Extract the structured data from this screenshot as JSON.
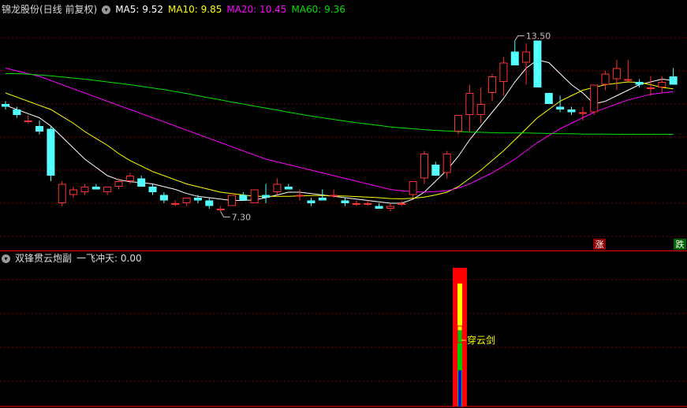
{
  "colors": {
    "up": "#ff3232",
    "down": "#54ffff",
    "ma5": "#ffffff",
    "ma10": "#ffff00",
    "ma20": "#ff00ff",
    "ma60": "#00e000",
    "grid": "#7a0000",
    "axis": "#ff0000",
    "label": "#c0c0c0"
  },
  "main_header": {
    "title": "锦龙股份(日线 前复权)",
    "ma5": "MA5: 9.52",
    "ma10": "MA10: 9.85",
    "ma20": "MA20: 10.45",
    "ma60": "MA60: 9.36"
  },
  "sub_header": {
    "title": "双锋贯云炮副",
    "indicator": "一飞冲天: 0.00"
  },
  "chart_data": [
    {
      "type": "candlestick",
      "title": "锦龙股份(日线 前复权)",
      "ylim": [
        6.0,
        14.4
      ],
      "high_marker": "13.50",
      "low_marker": "7.30",
      "badges": [
        "涨",
        "跌"
      ],
      "series": [
        {
          "name": "K线",
          "ohlc": [
            [
              11.2,
              11.3,
              11.0,
              11.1
            ],
            [
              11.0,
              11.1,
              10.7,
              10.8
            ],
            [
              10.6,
              10.8,
              10.5,
              10.6
            ],
            [
              10.4,
              10.6,
              10.1,
              10.2
            ],
            [
              10.3,
              10.4,
              8.4,
              8.6
            ],
            [
              7.6,
              8.4,
              7.5,
              8.3
            ],
            [
              7.9,
              8.2,
              7.8,
              8.1
            ],
            [
              8.0,
              8.3,
              7.9,
              8.2
            ],
            [
              8.2,
              8.3,
              8.1,
              8.1
            ],
            [
              8.0,
              8.2,
              7.9,
              8.2
            ],
            [
              8.2,
              8.5,
              8.1,
              8.4
            ],
            [
              8.4,
              8.7,
              8.3,
              8.6
            ],
            [
              8.5,
              8.6,
              8.2,
              8.2
            ],
            [
              8.2,
              8.3,
              7.9,
              8.0
            ],
            [
              7.9,
              8.0,
              7.6,
              7.7
            ],
            [
              7.6,
              7.7,
              7.5,
              7.6
            ],
            [
              7.6,
              7.8,
              7.5,
              7.8
            ],
            [
              7.8,
              7.9,
              7.6,
              7.7
            ],
            [
              7.7,
              7.8,
              7.4,
              7.5
            ],
            [
              7.4,
              7.5,
              7.3,
              7.4
            ],
            [
              7.5,
              7.9,
              7.5,
              7.9
            ],
            [
              7.9,
              8.0,
              7.7,
              7.7
            ],
            [
              7.6,
              8.1,
              7.6,
              8.1
            ],
            [
              7.9,
              8.3,
              7.6,
              7.8
            ],
            [
              8.0,
              8.5,
              7.9,
              8.3
            ],
            [
              8.2,
              8.3,
              8.1,
              8.1
            ],
            [
              7.9,
              8.1,
              7.7,
              7.9
            ],
            [
              7.7,
              7.8,
              7.5,
              7.6
            ],
            [
              7.8,
              8.1,
              7.7,
              7.7
            ],
            [
              7.9,
              8.1,
              7.8,
              7.9
            ],
            [
              7.7,
              7.8,
              7.5,
              7.6
            ],
            [
              7.6,
              7.7,
              7.5,
              7.6
            ],
            [
              7.6,
              7.7,
              7.5,
              7.6
            ],
            [
              7.5,
              7.6,
              7.4,
              7.4
            ],
            [
              7.4,
              7.6,
              7.3,
              7.5
            ],
            [
              7.6,
              7.7,
              7.5,
              7.6
            ],
            [
              7.9,
              8.4,
              7.8,
              8.4
            ],
            [
              8.5,
              9.5,
              8.3,
              9.4
            ],
            [
              9.0,
              9.1,
              8.6,
              8.6
            ],
            [
              8.7,
              9.5,
              8.5,
              9.4
            ],
            [
              10.2,
              10.8,
              10.1,
              10.8
            ],
            [
              10.8,
              11.9,
              10.2,
              11.6
            ],
            [
              10.8,
              11.8,
              10.5,
              11.2
            ],
            [
              11.6,
              12.3,
              11.3,
              12.2
            ],
            [
              12.0,
              12.9,
              11.5,
              12.7
            ],
            [
              13.1,
              13.5,
              12.6,
              12.6
            ],
            [
              12.7,
              13.4,
              11.9,
              13.1
            ],
            [
              13.5,
              13.5,
              11.8,
              11.8
            ],
            [
              11.6,
              11.6,
              11.2,
              11.2
            ],
            [
              11.1,
              11.5,
              10.9,
              11.0
            ],
            [
              11.0,
              11.1,
              10.8,
              10.9
            ],
            [
              10.9,
              11.1,
              10.6,
              10.9
            ],
            [
              10.9,
              11.9,
              10.8,
              11.9
            ],
            [
              11.9,
              12.4,
              11.7,
              12.3
            ],
            [
              12.1,
              12.8,
              11.7,
              12.5
            ],
            [
              12.1,
              12.8,
              12.0,
              12.1
            ],
            [
              12.0,
              12.1,
              11.8,
              11.9
            ],
            [
              11.8,
              12.2,
              11.5,
              11.8
            ],
            [
              11.8,
              12.2,
              11.6,
              12.0
            ],
            [
              12.2,
              12.5,
              11.9,
              11.9
            ]
          ]
        },
        {
          "name": "MA5",
          "values": [
            11.15,
            11.0,
            10.85,
            10.7,
            10.4,
            10.0,
            9.6,
            9.2,
            8.9,
            8.6,
            8.45,
            8.38,
            8.35,
            8.3,
            8.2,
            8.1,
            7.95,
            7.85,
            7.8,
            7.75,
            7.7,
            7.7,
            7.72,
            7.8,
            7.9,
            8.0,
            8.0,
            7.95,
            7.9,
            7.85,
            7.8,
            7.75,
            7.7,
            7.65,
            7.6,
            7.6,
            7.75,
            8.0,
            8.4,
            8.8,
            9.3,
            9.9,
            10.4,
            10.9,
            11.4,
            12.0,
            12.5,
            12.8,
            12.7,
            12.3,
            11.9,
            11.6,
            11.2,
            11.3,
            11.5,
            11.7,
            11.9,
            12.0,
            12.1,
            12.05
          ]
        },
        {
          "name": "MA10",
          "values": [
            11.6,
            11.45,
            11.3,
            11.15,
            11.0,
            10.75,
            10.5,
            10.2,
            9.95,
            9.7,
            9.4,
            9.15,
            8.95,
            8.75,
            8.6,
            8.45,
            8.3,
            8.2,
            8.1,
            8.0,
            7.95,
            7.9,
            7.85,
            7.85,
            7.85,
            7.85,
            7.87,
            7.88,
            7.88,
            7.87,
            7.86,
            7.84,
            7.82,
            7.8,
            7.77,
            7.76,
            7.78,
            7.82,
            7.9,
            8.0,
            8.2,
            8.5,
            8.8,
            9.15,
            9.5,
            9.9,
            10.3,
            10.7,
            11.0,
            11.3,
            11.5,
            11.7,
            11.8,
            11.9,
            11.95,
            12.0,
            11.98,
            11.9,
            11.8,
            11.75
          ]
        },
        {
          "name": "MA20",
          "values": [
            12.5,
            12.4,
            12.3,
            12.2,
            12.05,
            11.9,
            11.75,
            11.6,
            11.45,
            11.3,
            11.15,
            11.0,
            10.85,
            10.7,
            10.55,
            10.4,
            10.25,
            10.1,
            9.95,
            9.8,
            9.65,
            9.5,
            9.35,
            9.2,
            9.1,
            9.0,
            8.9,
            8.8,
            8.7,
            8.6,
            8.5,
            8.4,
            8.3,
            8.2,
            8.1,
            8.05,
            8.02,
            8.0,
            8.02,
            8.05,
            8.15,
            8.3,
            8.5,
            8.7,
            8.95,
            9.2,
            9.5,
            9.8,
            10.05,
            10.3,
            10.5,
            10.7,
            10.9,
            11.05,
            11.2,
            11.35,
            11.45,
            11.55,
            11.6,
            11.65
          ]
        },
        {
          "name": "MA60",
          "values": [
            12.3,
            12.3,
            12.28,
            12.25,
            12.22,
            12.18,
            12.14,
            12.1,
            12.05,
            12.0,
            11.95,
            11.9,
            11.84,
            11.78,
            11.72,
            11.65,
            11.58,
            11.5,
            11.42,
            11.35,
            11.27,
            11.2,
            11.12,
            11.05,
            10.98,
            10.9,
            10.83,
            10.76,
            10.7,
            10.64,
            10.58,
            10.52,
            10.47,
            10.42,
            10.37,
            10.33,
            10.3,
            10.27,
            10.24,
            10.22,
            10.2,
            10.18,
            10.17,
            10.16,
            10.15,
            10.15,
            10.15,
            10.14,
            10.13,
            10.12,
            10.12,
            10.11,
            10.11,
            10.11,
            10.1,
            10.1,
            10.1,
            10.1,
            10.1,
            10.1
          ]
        }
      ]
    },
    {
      "type": "bar",
      "title": "双锋贯云炮副",
      "annotation": "穿云剑",
      "signal_index": 40,
      "signal_value": 1
    }
  ]
}
